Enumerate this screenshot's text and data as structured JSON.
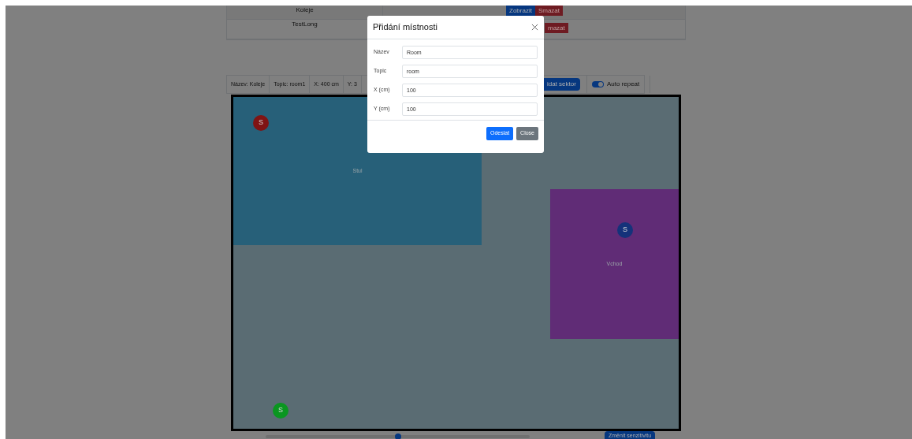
{
  "rooms_table": {
    "rows": [
      {
        "name": "Koleje",
        "actions": [
          {
            "label": "Zobrazit",
            "kind": "view"
          },
          {
            "label": "Smazat",
            "kind": "delete"
          }
        ]
      },
      {
        "name": "TestLong",
        "actions": [
          {
            "label": "mazat",
            "kind": "delete"
          }
        ]
      }
    ]
  },
  "info_bar": {
    "items": [
      "Název: Koleje",
      "Topic: room1",
      "X: 400 cm",
      "Y: 3"
    ],
    "add_sector_button": "idat sektor",
    "auto_repeat": {
      "label": "Auto repeat",
      "on": true
    }
  },
  "map": {
    "sectors": [
      {
        "name": "Stul",
        "color": "#276079"
      },
      {
        "name": "Vchod",
        "color": "#602c76"
      }
    ],
    "sensors": [
      {
        "label": "S",
        "color": "#801414"
      },
      {
        "label": "S",
        "color": "#15327a"
      },
      {
        "label": "S",
        "color": "#0a9620"
      }
    ]
  },
  "sensitivity": {
    "level": 0.5,
    "button": "Změnit senzitivitu"
  },
  "modal": {
    "title": "Přidání místnosti",
    "fields": [
      {
        "label": "Název",
        "value": "Room"
      },
      {
        "label": "Topic",
        "value": "room"
      },
      {
        "label": "X (cm)",
        "value": "100"
      },
      {
        "label": "Y (cm)",
        "value": "100"
      }
    ],
    "buttons": [
      {
        "label": "Odeslat",
        "kind": "primary"
      },
      {
        "label": "Close",
        "kind": "secondary"
      }
    ]
  }
}
